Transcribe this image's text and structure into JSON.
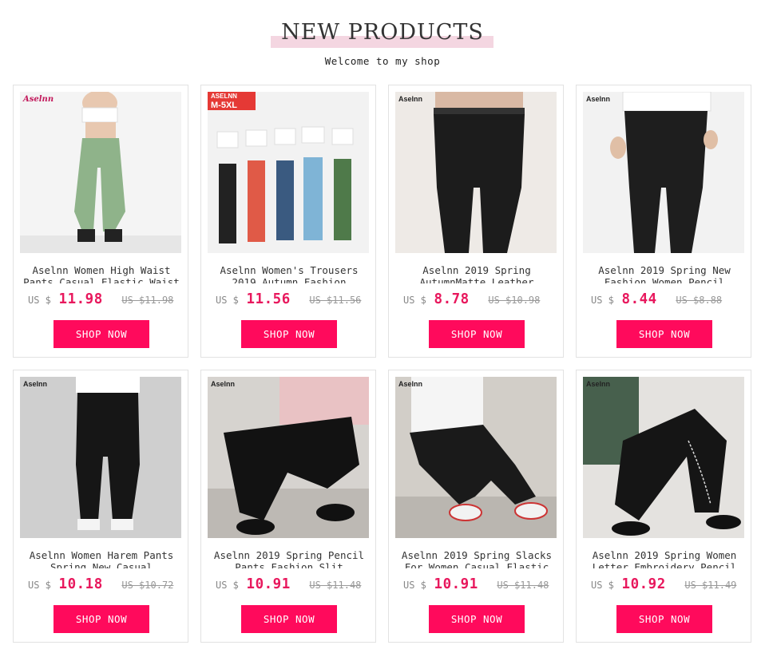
{
  "header": {
    "title": "NEW PRODUCTS",
    "subtitle": "Welcome to my shop"
  },
  "currency_label": "US $",
  "button_label": "SHOP NOW",
  "products": [
    {
      "name": "Aselnn Women High Waist Pants Casual Elastic Waist",
      "price": "11.98",
      "old_price": "US $11.98",
      "brand_mark": "Aselnn"
    },
    {
      "name": "Aselnn Women's Trousers 2019 Autumn Fashion",
      "price": "11.56",
      "old_price": "US $11.56",
      "brand_mark": "ASELNN",
      "size_badge": "M-5XL"
    },
    {
      "name": "Aselnn 2019 Spring AutumnMatte Leather",
      "price": "8.78",
      "old_price": "US $10.98",
      "brand_mark": "Aselnn"
    },
    {
      "name": "Aselnn 2019 Spring New Fashion Women Pencil",
      "price": "8.44",
      "old_price": "US $8.88",
      "brand_mark": "Aselnn"
    },
    {
      "name": "Aselnn Women Harem Pants Spring New Casual",
      "price": "10.18",
      "old_price": "US $10.72",
      "brand_mark": "Aselnn"
    },
    {
      "name": "Aselnn 2019 Spring Pencil Pants Fashion Slit",
      "price": "10.91",
      "old_price": "US $11.48",
      "brand_mark": "Aselnn"
    },
    {
      "name": "Aselnn 2019 Spring Slacks For Women Casual Elastic",
      "price": "10.91",
      "old_price": "US $11.48",
      "brand_mark": "Aselnn"
    },
    {
      "name": "Aselnn 2019 Spring Women Letter Embroidery Pencil",
      "price": "10.92",
      "old_price": "US $11.49",
      "brand_mark": "Aselnn"
    }
  ],
  "colors": {
    "accent": "#ff0a5c",
    "price": "#e8185d",
    "title_highlight": "#f4d6e1"
  }
}
